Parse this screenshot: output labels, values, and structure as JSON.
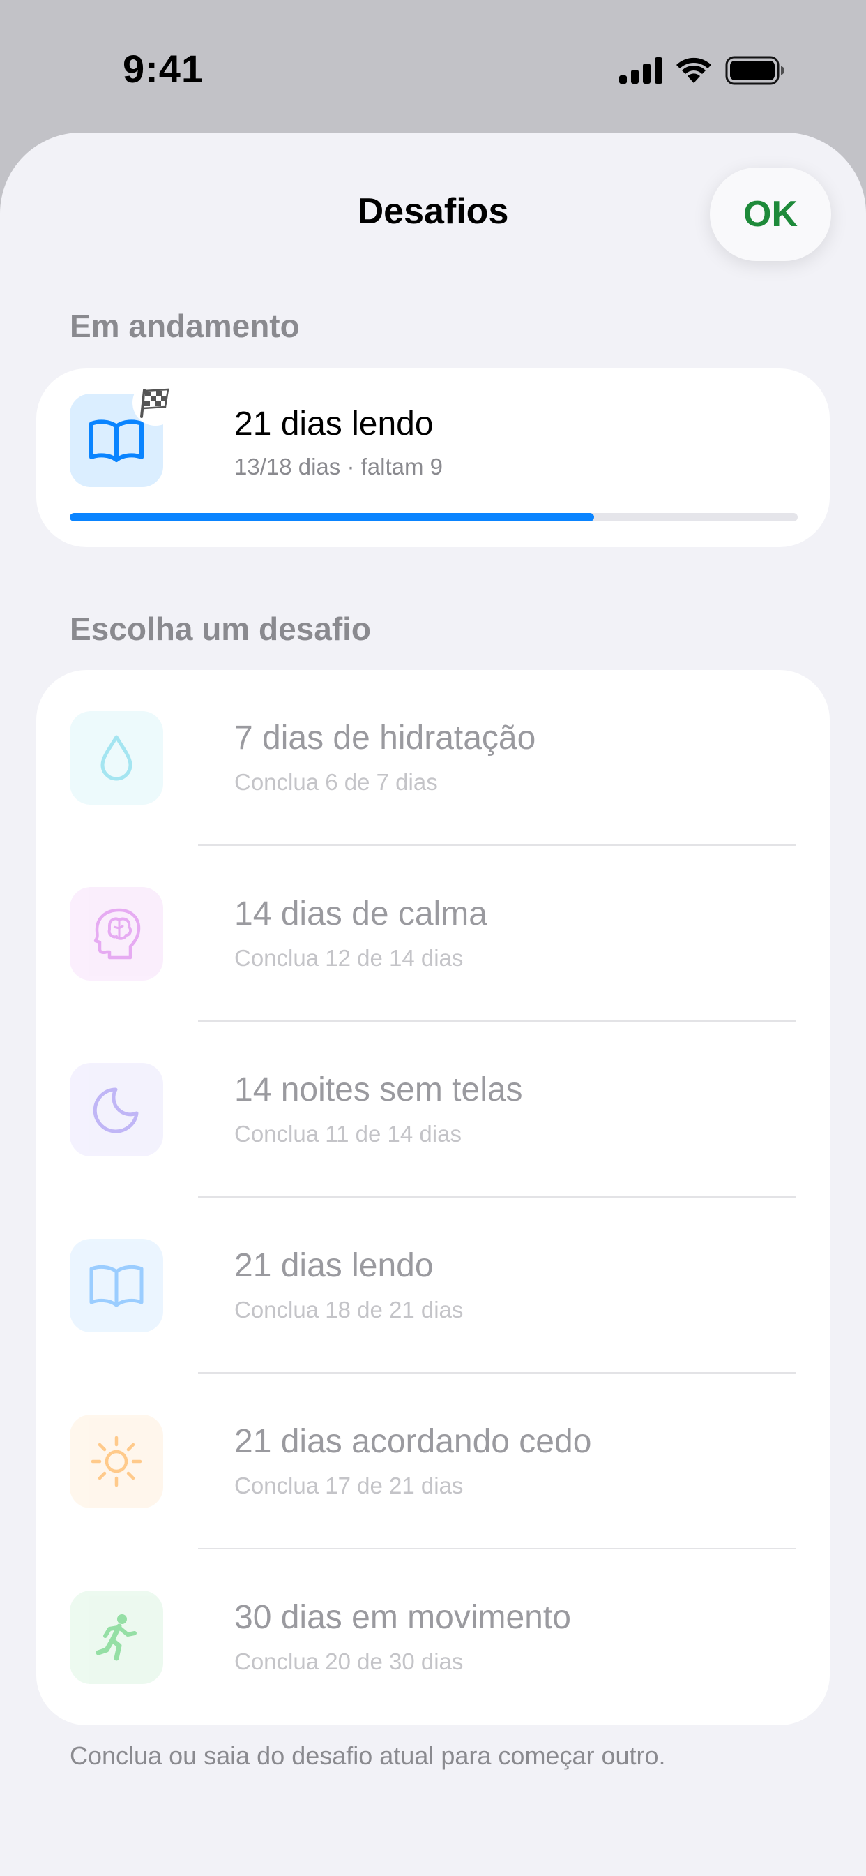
{
  "status_bar": {
    "time": "9:41"
  },
  "header": {
    "title": "Desafios",
    "ok_label": "OK"
  },
  "in_progress": {
    "section_label": "Em andamento",
    "challenge": {
      "title": "21 dias lendo",
      "subtitle": "13/18 dias · faltam 9",
      "progress": 0.72,
      "icon": "book-icon",
      "badge_icon": "checkered-flag-icon"
    }
  },
  "choose": {
    "section_label": "Escolha um desafio",
    "items": [
      {
        "title": "7 dias de hidratação",
        "subtitle": "Conclua 6 de 7 dias",
        "icon": "water-drop-icon",
        "color": "#5ad1e6"
      },
      {
        "title": "14 dias de calma",
        "subtitle": "Conclua 12 de 14 dias",
        "icon": "brain-head-icon",
        "color": "#d268e8"
      },
      {
        "title": "14 noites sem telas",
        "subtitle": "Conclua 11 de 14 dias",
        "icon": "moon-icon",
        "color": "#8e7cf0"
      },
      {
        "title": "21 dias lendo",
        "subtitle": "Conclua 18 de 21 dias",
        "icon": "book-icon",
        "color": "#4aa6ff"
      },
      {
        "title": "21 dias acordando cedo",
        "subtitle": "Conclua 17 de 21 dias",
        "icon": "sun-icon",
        "color": "#ff9f2e"
      },
      {
        "title": "30 dias em movimento",
        "subtitle": "Conclua 20 de 30 dias",
        "icon": "running-figure-icon",
        "color": "#3fc65c"
      }
    ]
  },
  "footer_note": "Conclua ou saia do desafio atual para começar outro.",
  "colors": {
    "accent_blue": "#0a84ff",
    "ok_green": "#1e8a3a",
    "sheet_bg": "#f2f2f7"
  }
}
